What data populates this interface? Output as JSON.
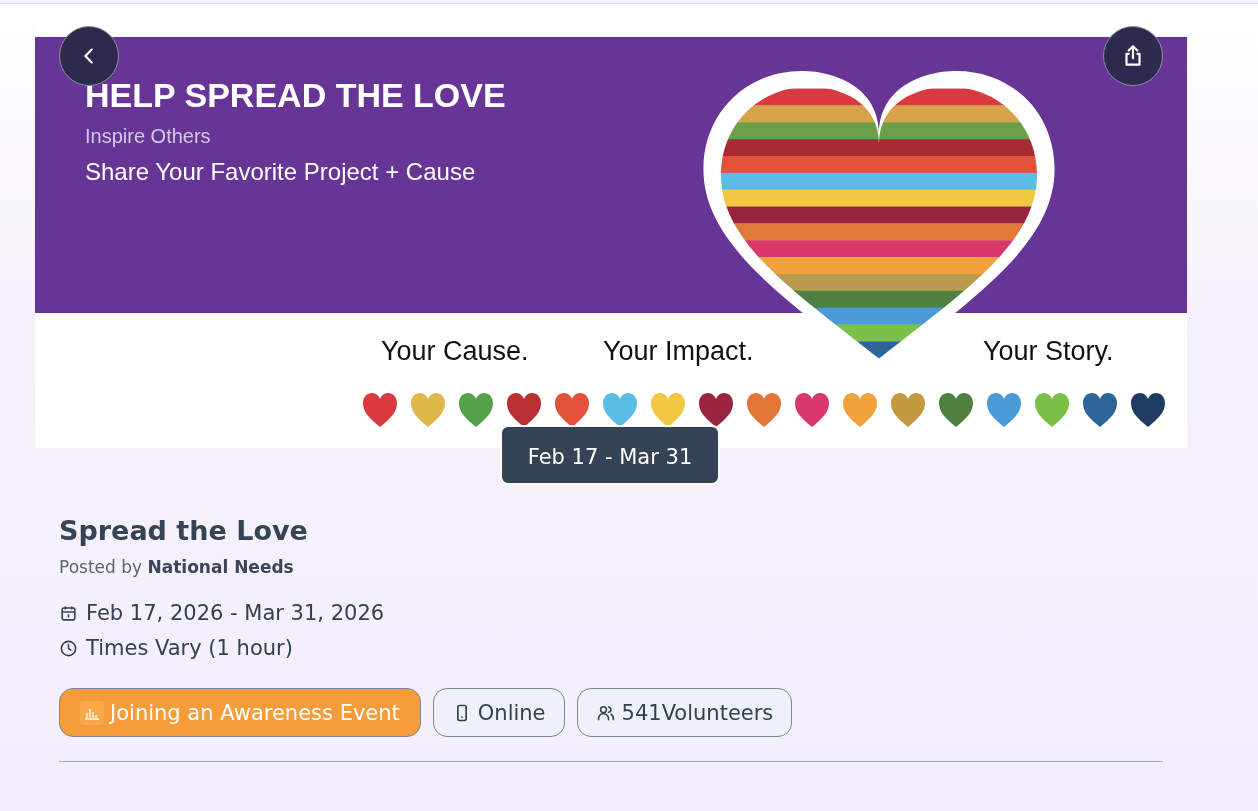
{
  "banner": {
    "headline": "HELP SPREAD THE LOVE",
    "subline": "Inspire Others",
    "tagline": "Share Your Favorite Project + Cause",
    "slogans": [
      "Your Cause.",
      "Your Impact.",
      "Your Story."
    ]
  },
  "date_badge": "Feb 17 - Mar 31",
  "event": {
    "title": "Spread the Love",
    "posted_by": "Posted by **National Needs**",
    "date_range": "Feb 17, 2026 - Mar 31, 2026",
    "time": "Times Vary (1 hour)"
  },
  "chips": [
    {
      "kind": "category",
      "label": "Joining an Awareness Event"
    },
    {
      "kind": "location",
      "label": "Online"
    },
    {
      "kind": "volunteers",
      "label": "541Volunteers"
    }
  ]
}
